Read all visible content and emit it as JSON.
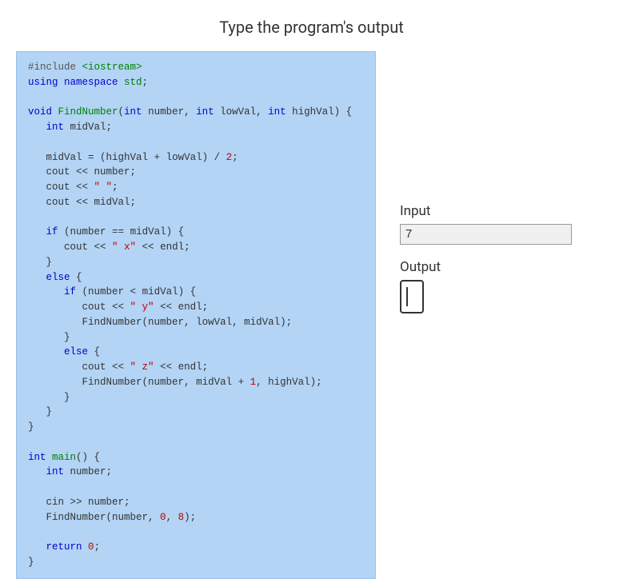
{
  "title": "Type the program's output",
  "code": {
    "l1_a": "#include ",
    "l1_b": "<iostream>",
    "l2_a": "using",
    "l2_b": " namespace",
    "l2_c": " std",
    "l3_a": "void",
    "l3_b": " FindNumber",
    "l3_c": "int",
    "l3_d": " number",
    "l3_e": "int",
    "l3_f": " lowVal",
    "l3_g": "int",
    "l3_h": " highVal",
    "l4_a": "int",
    "l4_b": " midVal",
    "l5_a": "   midVal ",
    "l5_b": " (highVal ",
    "l5_c": " lowVal) ",
    "l5_d": "2",
    "l6_a": "   cout ",
    "l6_b": " number",
    "l7_a": "   cout ",
    "l7_b": "\" \"",
    "l8_a": "   cout ",
    "l8_b": " midVal",
    "l9_a": "if",
    "l9_b": " (number ",
    "l9_c": " midVal) ",
    "l10_a": "      cout ",
    "l10_b": "\" x\"",
    "l10_c": " endl",
    "l11_a": "else",
    "l12_a": "if",
    "l12_b": " (number ",
    "l12_c": " midVal) ",
    "l13_a": "         cout ",
    "l13_b": "\" y\"",
    "l13_c": " endl",
    "l14_a": "         FindNumber(number",
    "l14_b": " lowVal",
    "l14_c": " midVal)",
    "l15_a": "else",
    "l16_a": "         cout ",
    "l16_b": "\" z\"",
    "l16_c": " endl",
    "l17_a": "         FindNumber(number",
    "l17_b": " midVal ",
    "l17_c": "1",
    "l17_d": " highVal)",
    "l18_a": "int",
    "l18_b": " main",
    "l19_a": "int",
    "l19_b": " number",
    "l20_a": "   cin ",
    "l20_b": " number",
    "l21_a": "   FindNumber(number",
    "l21_b": "0",
    "l21_c": "8",
    "l22_a": "return",
    "l22_b": "0"
  },
  "side": {
    "input_label": "Input",
    "input_value": "7",
    "output_label": "Output",
    "output_value": ""
  }
}
